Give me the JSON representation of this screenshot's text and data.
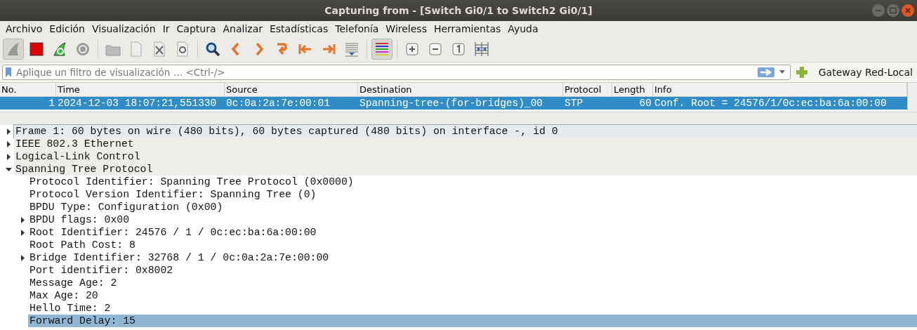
{
  "window": {
    "title": "Capturing from - [Switch Gi0/1 to Switch2 Gi0/1]"
  },
  "menu": [
    "Archivo",
    "Edición",
    "Visualización",
    "Ir",
    "Captura",
    "Analizar",
    "Estadísticas",
    "Telefonía",
    "Wireless",
    "Herramientas",
    "Ayuda"
  ],
  "toolbar": [
    {
      "kind": "fin",
      "on": true
    },
    {
      "kind": "stop",
      "on": false
    },
    {
      "kind": "restart",
      "on": false
    },
    {
      "kind": "options",
      "on": false
    },
    {
      "kind": "sep"
    },
    {
      "kind": "open",
      "on": false
    },
    {
      "kind": "file",
      "on": false
    },
    {
      "kind": "close",
      "on": false
    },
    {
      "kind": "reload",
      "on": false
    },
    {
      "kind": "sep"
    },
    {
      "kind": "search",
      "on": false
    },
    {
      "kind": "back",
      "on": false
    },
    {
      "kind": "forward",
      "on": false
    },
    {
      "kind": "jump",
      "on": false
    },
    {
      "kind": "first",
      "on": false
    },
    {
      "kind": "last",
      "on": false
    },
    {
      "kind": "autoscroll",
      "on": false
    },
    {
      "kind": "sep"
    },
    {
      "kind": "colorize",
      "on": true
    },
    {
      "kind": "sep"
    },
    {
      "kind": "zoomin",
      "on": false
    },
    {
      "kind": "zoomout",
      "on": false
    },
    {
      "kind": "normal",
      "on": false
    },
    {
      "kind": "resize",
      "on": false
    }
  ],
  "filter": {
    "placeholder": "Aplique un filtro de visualización … <Ctrl-/>",
    "button": "Gateway Red-Local"
  },
  "packet_list": {
    "columns": [
      "No.",
      "Time",
      "Source",
      "Destination",
      "Protocol",
      "Length",
      "Info"
    ],
    "rows": [
      {
        "selected": true,
        "cells": [
          "1",
          "2024-12-03 18:07:21,551330",
          "0c:0a:2a:7e:00:01",
          "Spanning-tree-(for-bridges)_00",
          "STP",
          "60",
          "Conf. Root = 24576/1/0c:ec:ba:6a:00:00"
        ]
      }
    ]
  },
  "details": [
    {
      "text": "Frame 1: 60 bytes on wire (480 bits), 60 bytes captured (480 bits) on interface -, id 0",
      "expanded": false,
      "selected": false
    },
    {
      "text": "IEEE 802.3 Ethernet",
      "expanded": false,
      "selected": false
    },
    {
      "text": "Logical-Link Control",
      "expanded": false,
      "selected": false
    },
    {
      "text": "Spanning Tree Protocol",
      "expanded": true,
      "selected": false,
      "children": [
        {
          "text": "Protocol Identifier: Spanning Tree Protocol (0x0000)",
          "selected": false
        },
        {
          "text": "Protocol Version Identifier: Spanning Tree (0)",
          "selected": false
        },
        {
          "text": "BPDU Type: Configuration (0x00)",
          "selected": false
        },
        {
          "text": "BPDU flags: 0x00",
          "expanded": false,
          "selected": false
        },
        {
          "text": "Root Identifier: 24576 / 1 / 0c:ec:ba:6a:00:00",
          "expanded": false,
          "selected": false
        },
        {
          "text": "Root Path Cost: 8",
          "selected": false
        },
        {
          "text": "Bridge Identifier: 32768 / 1 / 0c:0a:2a:7e:00:00",
          "expanded": false,
          "selected": false
        },
        {
          "text": "Port identifier: 0x8002",
          "selected": false
        },
        {
          "text": "Message Age: 2",
          "selected": false
        },
        {
          "text": "Max Age: 20",
          "selected": false
        },
        {
          "text": "Hello Time: 2",
          "selected": false
        },
        {
          "text": "Forward Delay: 15",
          "selected": true
        }
      ]
    }
  ]
}
